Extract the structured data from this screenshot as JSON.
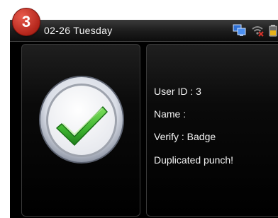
{
  "step_badge": "3",
  "topbar": {
    "date_text": "02-26  Tuesday",
    "icons": [
      "network-icon",
      "wifi-icon",
      "battery-icon"
    ]
  },
  "result": {
    "icon": "checkmark-icon",
    "lines": [
      "User ID : 3",
      "Name :",
      "Verify : Badge",
      "Duplicated punch!"
    ]
  },
  "colors": {
    "check_green": "#3db32f",
    "badge_red": "#c8352a",
    "screen_bg": "#000000"
  }
}
